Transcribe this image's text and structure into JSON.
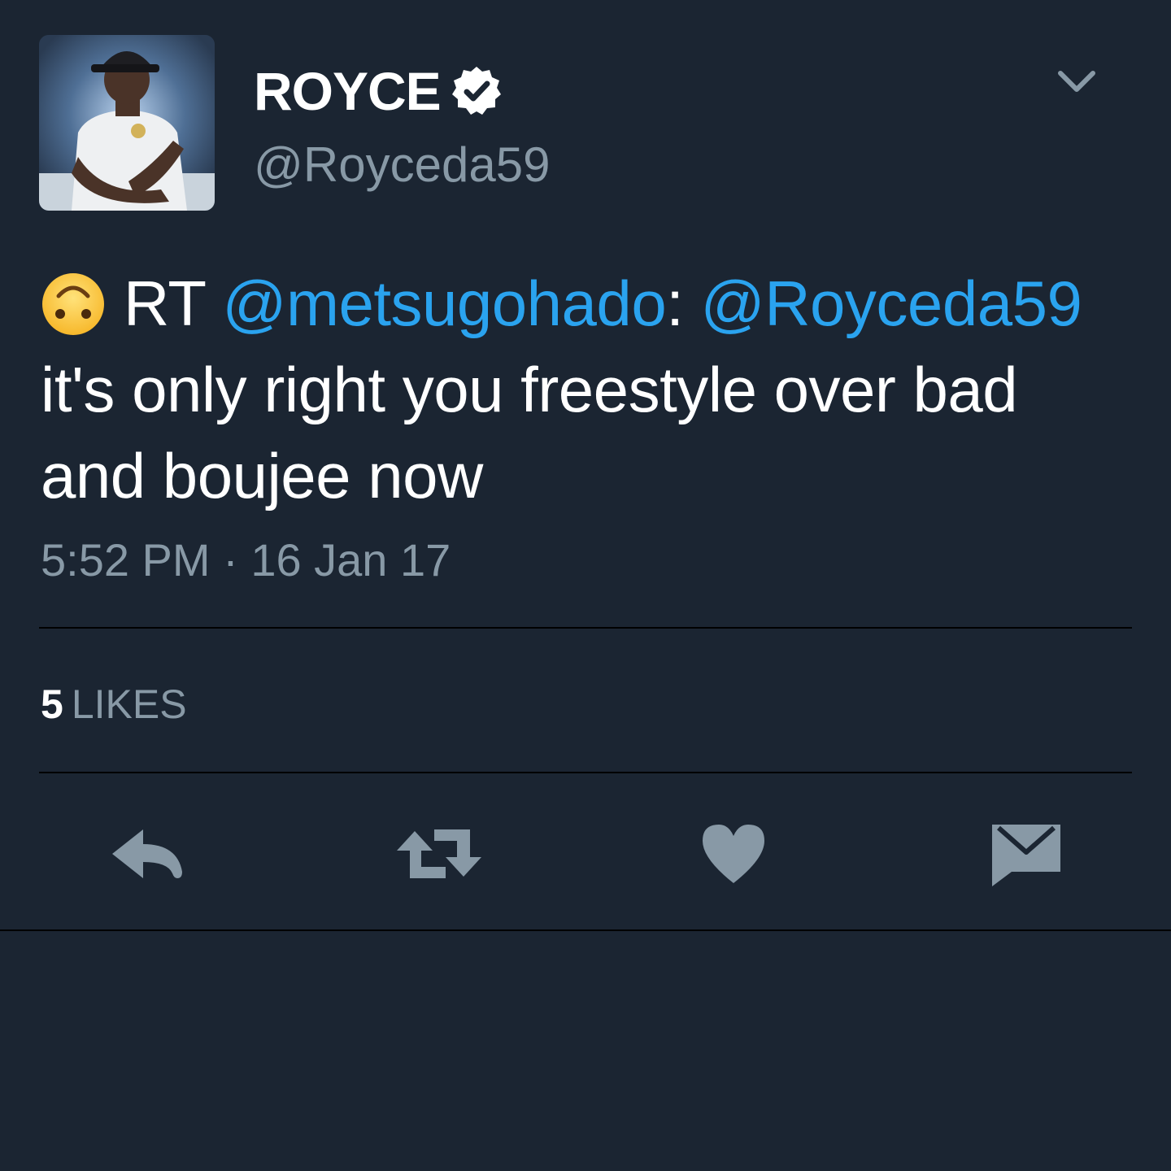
{
  "header": {
    "display_name": "ROYCE",
    "handle": "@Royceda59",
    "verified": true
  },
  "tweet": {
    "emoji": "upside-down-face",
    "prefix": "RT",
    "mention_1": "@metsugohado",
    "colon": ":",
    "mention_2": "@Royceda59",
    "body": "it's only right you freestyle over bad and boujee now",
    "timestamp": "5:52 PM · 16 Jan 17"
  },
  "stats": {
    "likes_count": "5",
    "likes_label": "LIKES"
  },
  "actions": [
    {
      "name": "reply",
      "icon": "reply-icon"
    },
    {
      "name": "retweet",
      "icon": "retweet-icon"
    },
    {
      "name": "like",
      "icon": "heart-icon"
    },
    {
      "name": "direct-message",
      "icon": "envelope-icon"
    }
  ],
  "colors": {
    "background": "#1b2532",
    "text": "#ffffff",
    "secondary": "#8899a6",
    "link": "#2aa3ef",
    "divider": "#000000"
  }
}
